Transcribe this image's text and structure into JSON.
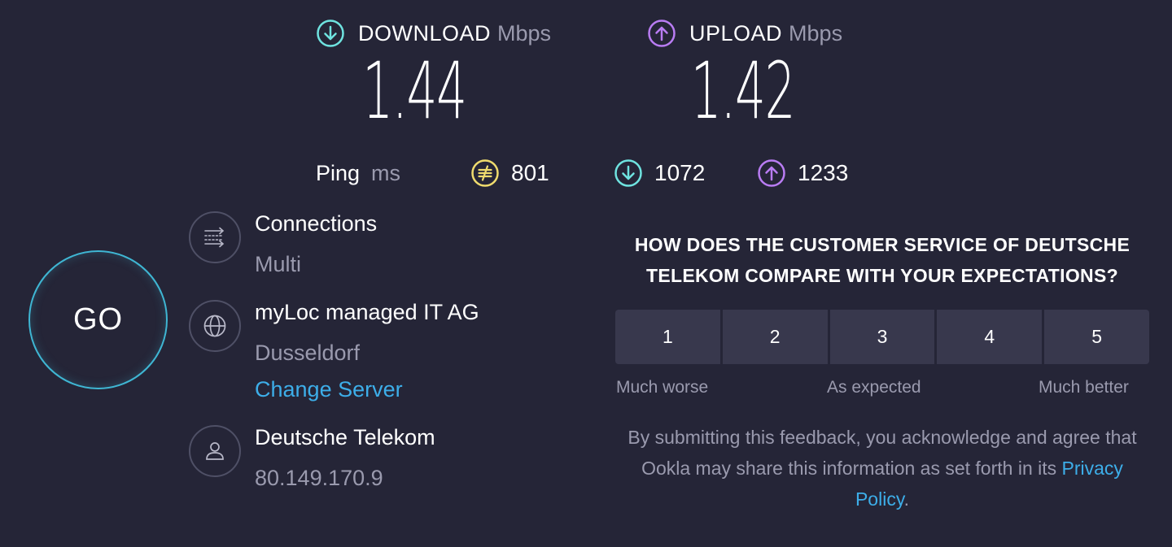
{
  "download": {
    "label": "DOWNLOAD",
    "unit": "Mbps",
    "value": "1.44",
    "icon": "download-arrow-icon",
    "color": "#6fe3e0"
  },
  "upload": {
    "label": "UPLOAD",
    "unit": "Mbps",
    "value": "1.42",
    "icon": "upload-arrow-icon",
    "color": "#b97cf3"
  },
  "ping": {
    "label": "Ping",
    "unit": "ms",
    "idle": {
      "value": "801",
      "icon": "idle-latency-icon",
      "color": "#f0dc6e"
    },
    "download": {
      "value": "1072",
      "icon": "download-latency-icon",
      "color": "#6fe3e0"
    },
    "upload": {
      "value": "1233",
      "icon": "upload-latency-icon",
      "color": "#b97cf3"
    }
  },
  "go_button": {
    "label": "GO",
    "color": "#3fb6d3"
  },
  "connections": {
    "title": "Connections",
    "value": "Multi",
    "icon": "connections-icon"
  },
  "server": {
    "title": "myLoc managed IT AG",
    "location": "Dusseldorf",
    "change_label": "Change Server",
    "icon": "globe-icon"
  },
  "isp": {
    "title": "Deutsche Telekom",
    "ip": "80.149.170.9",
    "icon": "user-icon"
  },
  "survey": {
    "question": "HOW DOES THE CUSTOMER SERVICE OF DEUTSCHE TELEKOM COMPARE WITH YOUR EXPECTATIONS?",
    "ratings": [
      "1",
      "2",
      "3",
      "4",
      "5"
    ],
    "scale_low": "Much worse",
    "scale_mid": "As expected",
    "scale_high": "Much better",
    "disclaimer": "By submitting this feedback, you acknowledge and agree that Ookla may share this information as set forth in its",
    "privacy_link": "Privacy Policy",
    "trailing": "."
  },
  "colors": {
    "background": "#252537",
    "link": "#3daee9",
    "muted": "#9a9aae"
  }
}
